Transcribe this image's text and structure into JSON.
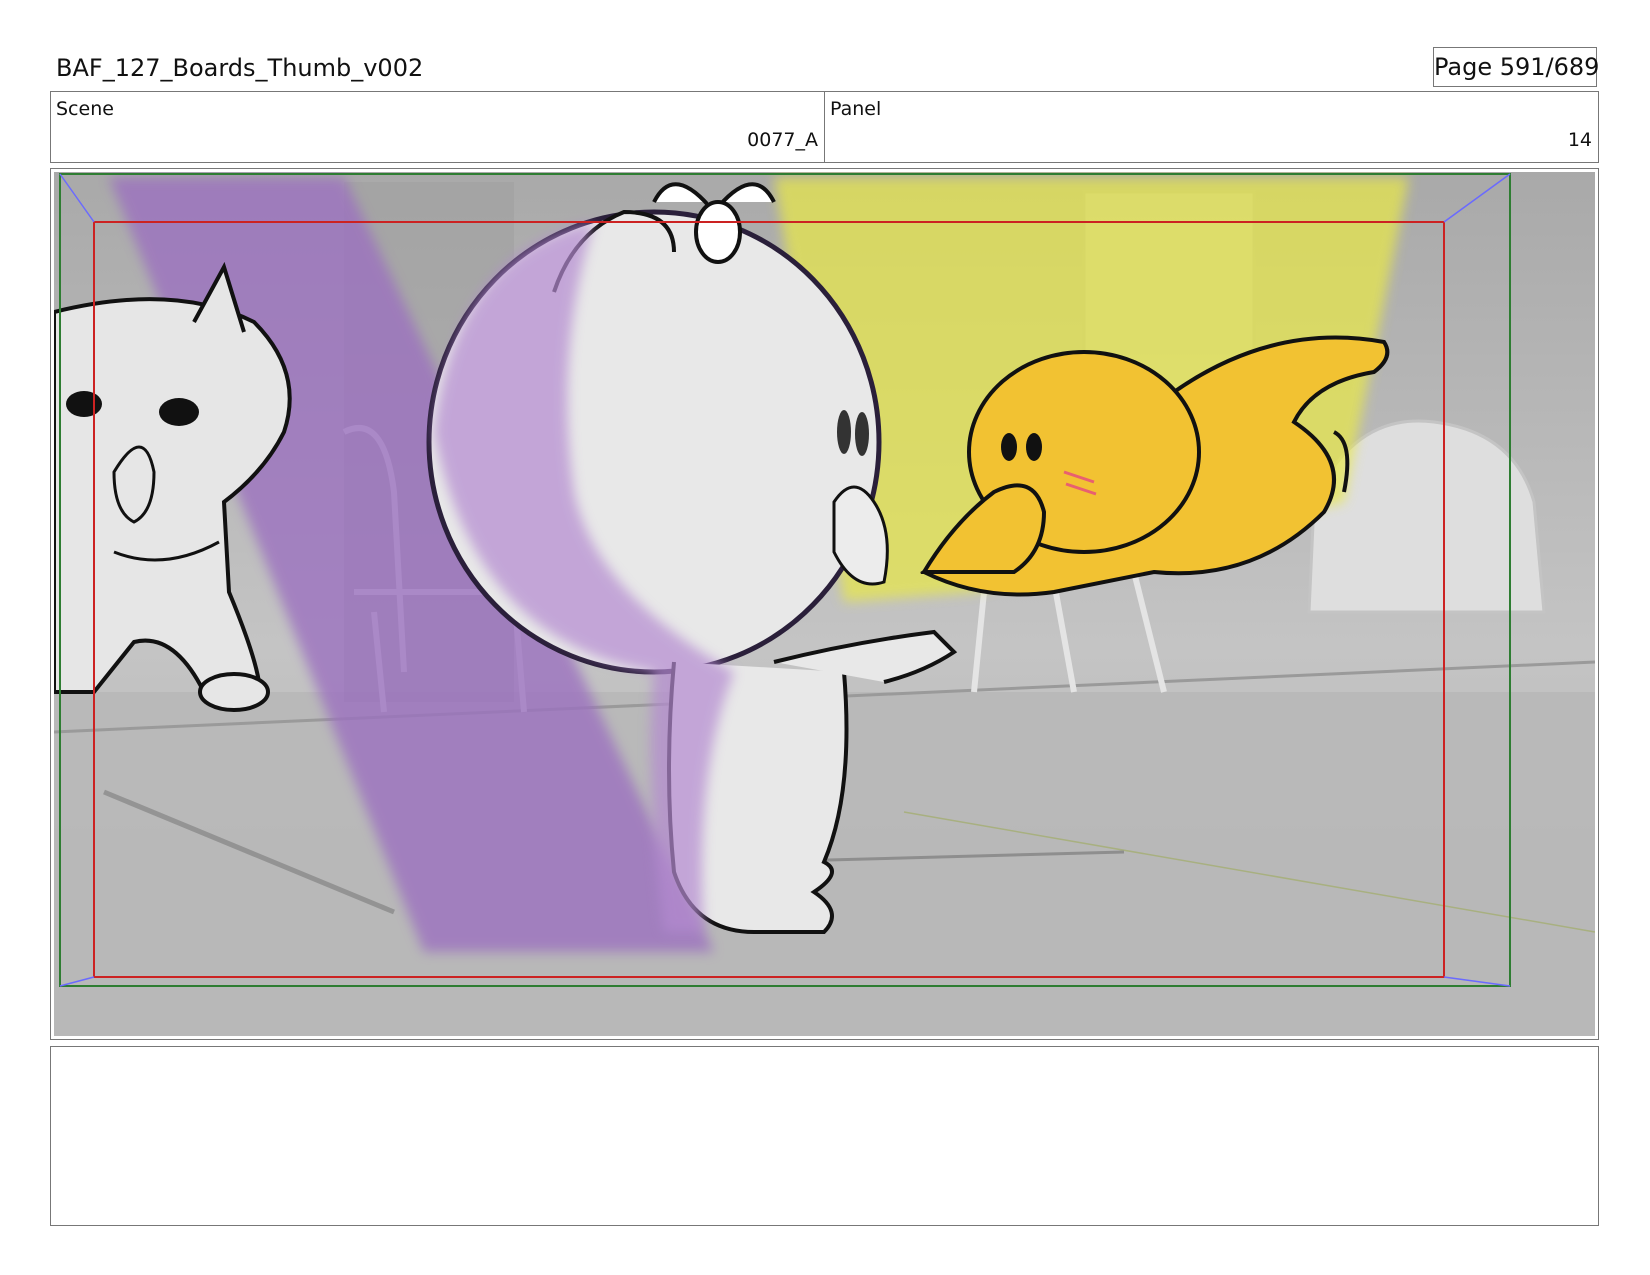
{
  "header": {
    "title": "BAF_127_Boards_Thumb_v002",
    "page_label": "Page 591/689"
  },
  "scene": {
    "label": "Scene",
    "value": "0077_A"
  },
  "panel": {
    "label": "Panel",
    "value": "14"
  },
  "frame": {
    "colors": {
      "safe_frame": "#cc2222",
      "camera_frame": "#2e7d32",
      "spotlight_purple": "#9b6fc0",
      "spotlight_yellow": "#e8e84a",
      "character_yellow": "#f2c232",
      "background_gray": "#bdbdbd"
    }
  },
  "notes": {
    "text": ""
  }
}
